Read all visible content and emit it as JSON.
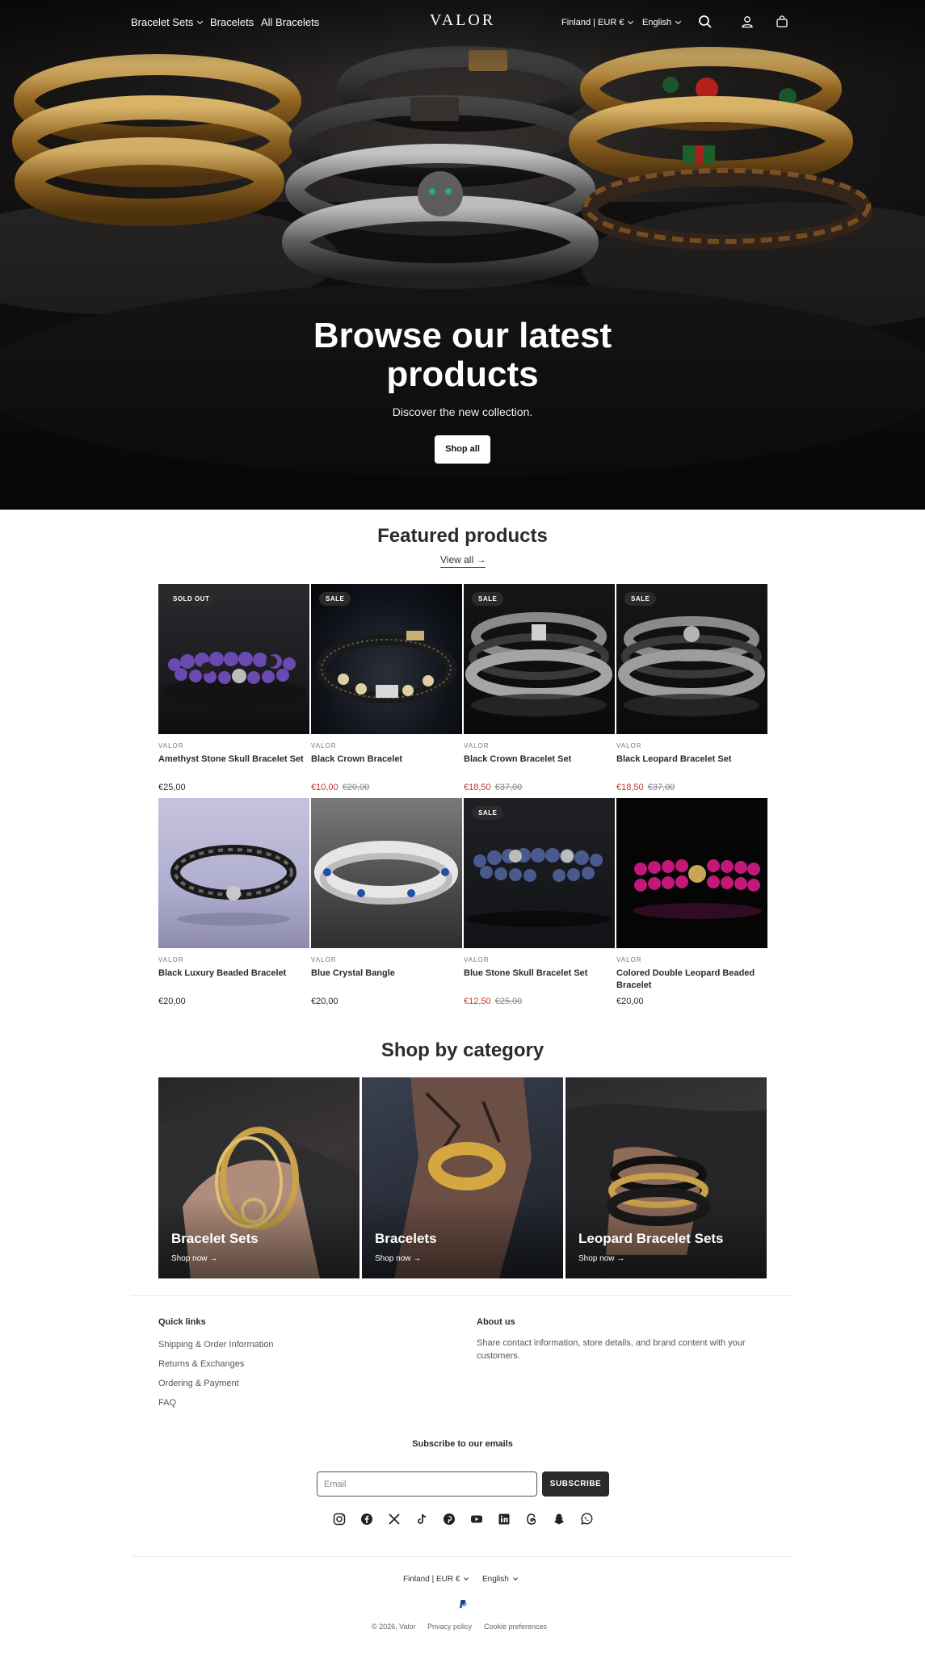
{
  "header": {
    "nav": [
      {
        "label": "Bracelet Sets",
        "dropdown": true
      },
      {
        "label": "Bracelets",
        "dropdown": false
      },
      {
        "label": "All Bracelets",
        "dropdown": false
      }
    ],
    "logo": "VALOR",
    "country": "Finland | EUR €",
    "language": "English",
    "icons": [
      "search-icon",
      "account-icon",
      "cart-icon"
    ]
  },
  "hero": {
    "title_line1": "Browse our latest",
    "title_line2": "products",
    "subtitle": "Discover the new collection.",
    "button": "Shop all"
  },
  "featured": {
    "title": "Featured products",
    "view_all": "View all →",
    "products": [
      {
        "badge": "SOLD OUT",
        "vendor": "VALOR",
        "name": "Amethyst Stone Skull Bracelet Set",
        "price": "€25,00",
        "old_price": ""
      },
      {
        "badge": "SALE",
        "vendor": "VALOR",
        "name": "Black Crown Bracelet",
        "price": "€10,00",
        "old_price": "€20,00"
      },
      {
        "badge": "SALE",
        "vendor": "VALOR",
        "name": "Black Crown Bracelet Set",
        "price": "€18,50",
        "old_price": "€37,00"
      },
      {
        "badge": "SALE",
        "vendor": "VALOR",
        "name": "Black Leopard Bracelet Set",
        "price": "€18,50",
        "old_price": "€37,00"
      },
      {
        "badge": "",
        "vendor": "VALOR",
        "name": "Black Luxury Beaded Bracelet",
        "price": "€20,00",
        "old_price": ""
      },
      {
        "badge": "",
        "vendor": "VALOR",
        "name": "Blue Crystal Bangle",
        "price": "€20,00",
        "old_price": ""
      },
      {
        "badge": "SALE",
        "vendor": "VALOR",
        "name": "Blue Stone Skull Bracelet Set",
        "price": "€12,50",
        "old_price": "€25,00"
      },
      {
        "badge": "",
        "vendor": "VALOR",
        "name": "Colored Double Leopard Beaded Bracelet",
        "price": "€20,00",
        "old_price": ""
      }
    ]
  },
  "categories": {
    "title": "Shop by category",
    "items": [
      {
        "title": "Bracelet Sets",
        "link": "Shop now →"
      },
      {
        "title": "Bracelets",
        "link": "Shop now →"
      },
      {
        "title": "Leopard Bracelet Sets",
        "link": "Shop now →"
      }
    ]
  },
  "footer": {
    "quick_links_title": "Quick links",
    "quick_links": [
      "Shipping & Order Information",
      "Returns & Exchanges",
      "Ordering & Payment",
      "FAQ"
    ],
    "about_title": "About us",
    "about_text": "Share contact information, store details, and brand content with your customers.",
    "subscribe_title": "Subscribe to our emails",
    "email_placeholder": "Email",
    "subscribe_button": "SUBSCRIBE",
    "social": [
      "instagram-icon",
      "facebook-icon",
      "x-icon",
      "tiktok-icon",
      "pinterest-icon",
      "youtube-icon",
      "linkedin-icon",
      "threads-icon",
      "snapchat-icon",
      "whatsapp-icon"
    ],
    "country": "Finland | EUR €",
    "language": "English",
    "payment_icon": "paypal-icon",
    "copyright": "© 2026, Valor",
    "privacy": "Privacy policy",
    "cookies": "Cookie preferences"
  },
  "colors": {
    "sale": "#c0392b",
    "dark": "#2b2b2b",
    "hero_bg": "#111111"
  }
}
